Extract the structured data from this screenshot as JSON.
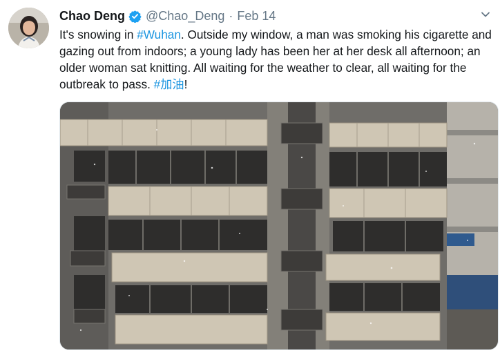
{
  "tweet": {
    "author_name": "Chao Deng",
    "handle": "@Chao_Deng",
    "separator": "·",
    "date": "Feb 14",
    "text_part1": "It's snowing in ",
    "hashtag1": "#Wuhan",
    "text_part2": ". Outside my window, a man was smoking his cigarette and gazing out from indoors; a young lady has been her at her desk all afternoon; an older woman sat knitting. All waiting for the weather to clear, all waiting for the outbreak to pass. ",
    "hashtag2": "#加油",
    "text_part3": "!"
  },
  "icons": {
    "verified": "verified-badge-icon",
    "caret": "chevron-down-icon"
  },
  "colors": {
    "link": "#1b95e0",
    "secondary_text": "#657786",
    "verified_blue": "#1da1f2"
  }
}
